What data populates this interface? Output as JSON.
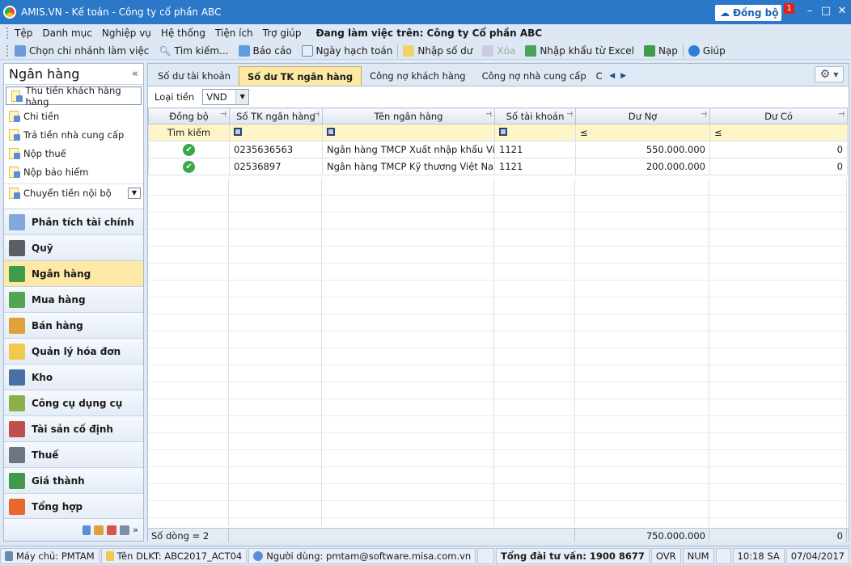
{
  "window": {
    "title": "AMIS.VN - Kế toán - Công ty cổ phần ABC",
    "sync_label": "Đồng bộ",
    "sync_badge": "1"
  },
  "menu": {
    "items": [
      "Tệp",
      "Danh mục",
      "Nghiệp vụ",
      "Hệ thống",
      "Tiện ích",
      "Trợ giúp"
    ],
    "working_on": "Đang làm việc trên: Công ty Cổ phần ABC"
  },
  "toolbar": {
    "branch": "Chọn chi nhánh làm việc",
    "search": "Tìm kiếm...",
    "report": "Báo cáo",
    "posting_date": "Ngày hạch toán",
    "opening_balance": "Nhập số dư",
    "delete": "Xóa",
    "import_excel": "Nhập khẩu từ Excel",
    "reload": "Nạp",
    "help": "Giúp"
  },
  "sidebar": {
    "title": "Ngân hàng",
    "shortcuts": [
      "Thu tiền khách hàng hàng",
      "Chi tiền",
      "Trả tiền nhà cung cấp",
      "Nộp thuế",
      "Nộp bảo hiểm",
      "Chuyển tiền nội bộ"
    ],
    "modules": [
      "Phân tích tài chính",
      "Quỹ",
      "Ngân hàng",
      "Mua hàng",
      "Bán hàng",
      "Quản lý hóa đơn",
      "Kho",
      "Công cụ dụng cụ",
      "Tài sản cố định",
      "Thuế",
      "Giá thành",
      "Tổng hợp"
    ],
    "active_module": "Ngân hàng"
  },
  "tabs": [
    "Số dư tài khoản",
    "Số dư TK ngân hàng",
    "Công nợ khách hàng",
    "Công nợ nhà cung cấp",
    "C"
  ],
  "active_tab": "Số dư TK ngân hàng",
  "filter": {
    "label": "Loại tiền",
    "value": "VND"
  },
  "grid": {
    "columns": [
      "Đồng bộ",
      "Số TK ngân hàng",
      "Tên ngân hàng",
      "Số tài khoản",
      "Dư Nợ",
      "Dư Có"
    ],
    "search_label": "Tìm kiếm",
    "le_symbol": "≤",
    "rows": [
      {
        "account_no": "0235636563",
        "bank": "Ngân hàng TMCP Xuất nhập khẩu Việt",
        "ledger": "1121",
        "debit": "550.000.000",
        "credit": "0"
      },
      {
        "account_no": "02536897",
        "bank": "Ngân hàng TMCP Kỹ thương Việt Nam -",
        "ledger": "1121",
        "debit": "200.000.000",
        "credit": "0"
      }
    ],
    "footer": {
      "count": "Số dòng = 2",
      "debit_total": "750.000.000",
      "credit_total": "0"
    }
  },
  "status": {
    "server": "Máy chủ: PMTAM",
    "db": "Tên DLKT: ABC2017_ACT04",
    "user": "Người dùng: pmtam@software.misa.com.vn",
    "hotline": "Tổng đài tư vấn: 1900 8677",
    "ovr": "OVR",
    "num": "NUM",
    "time": "10:18 SA",
    "date": "07/04/2017"
  },
  "colors": {
    "title_bar": "#2b78c8",
    "active_tab": "#fde9a5",
    "search_row": "#fdf5c8",
    "sync_ok": "#3aa847"
  }
}
